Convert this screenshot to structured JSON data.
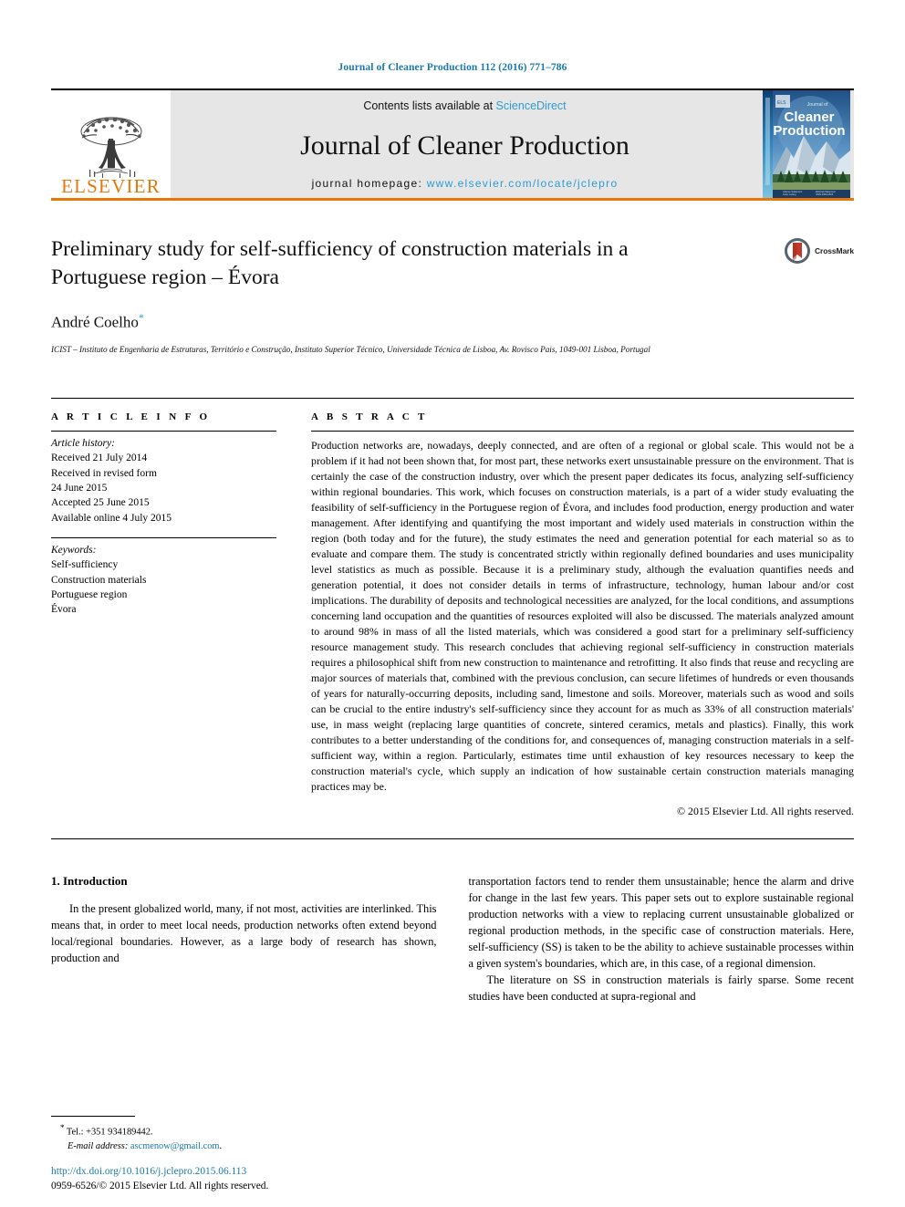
{
  "running_head": "Journal of Cleaner Production 112 (2016) 771–786",
  "masthead": {
    "publisher_name": "ELSEVIER",
    "contents_prefix": "Contents lists available at ",
    "contents_link": "ScienceDirect",
    "journal_name": "Journal of Cleaner Production",
    "homepage_prefix": "journal homepage: ",
    "homepage_url": "www.elsevier.com/locate/jclepro",
    "cover": {
      "kicker": "Journal of",
      "line1": "Cleaner",
      "line2": "Production"
    },
    "link_color": "#2e9bd0",
    "rule_color": "#e8770a",
    "band_color": "#e6e6e6"
  },
  "title_block": {
    "title": "Preliminary study for self-sufficiency of construction materials in a Portuguese region – Évora",
    "author": "André Coelho",
    "author_marker": "*",
    "affiliation": "ICIST – Instituto de Engenharia de Estruturas, Território e Construção, Instituto Superior Técnico, Universidade Técnica de Lisboa, Av. Rovisco Pais, 1049-001 Lisboa, Portugal",
    "crossmark_label": "CrossMark"
  },
  "article_info": {
    "heading": "A R T I C L E   I N F O",
    "history_label": "Article history:",
    "history": [
      "Received 21 July 2014",
      "Received in revised form",
      "24 June 2015",
      "Accepted 25 June 2015",
      "Available online 4 July 2015"
    ],
    "keywords_label": "Keywords:",
    "keywords": [
      "Self-sufficiency",
      "Construction materials",
      "Portuguese region",
      "Évora"
    ]
  },
  "abstract": {
    "heading": "A B S T R A C T",
    "text": "Production networks are, nowadays, deeply connected, and are often of a regional or global scale. This would not be a problem if it had not been shown that, for most part, these networks exert unsustainable pressure on the environment. That is certainly the case of the construction industry, over which the present paper dedicates its focus, analyzing self-sufficiency within regional boundaries. This work, which focuses on construction materials, is a part of a wider study evaluating the feasibility of self-sufficiency in the Portuguese region of Évora, and includes food production, energy production and water management. After identifying and quantifying the most important and widely used materials in construction within the region (both today and for the future), the study estimates the need and generation potential for each material so as to evaluate and compare them. The study is concentrated strictly within regionally defined boundaries and uses municipality level statistics as much as possible. Because it is a preliminary study, although the evaluation quantifies needs and generation potential, it does not consider details in terms of infrastructure, technology, human labour and/or cost implications. The durability of deposits and technological necessities are analyzed, for the local conditions, and assumptions concerning land occupation and the quantities of resources exploited will also be discussed. The materials analyzed amount to around 98% in mass of all the listed materials, which was considered a good start for a preliminary self-sufficiency resource management study. This research concludes that achieving regional self-sufficiency in construction materials requires a philosophical shift from new construction to maintenance and retrofitting. It also finds that reuse and recycling are major sources of materials that, combined with the previous conclusion, can secure lifetimes of hundreds or even thousands of years for naturally-occurring deposits, including sand, limestone and soils. Moreover, materials such as wood and soils can be crucial to the entire industry's self-sufficiency since they account for as much as 33% of all construction materials' use, in mass weight (replacing large quantities of concrete, sintered ceramics, metals and plastics). Finally, this work contributes to a better understanding of the conditions for, and consequences of, managing construction materials in a self-sufficient way, within a region. Particularly, estimates time until exhaustion of key resources necessary to keep the construction material's cycle, which supply an indication of how sustainable certain construction materials managing practices may be.",
    "copyright": "© 2015 Elsevier Ltd. All rights reserved."
  },
  "introduction": {
    "section_number_title": "1. Introduction",
    "left_para": "In the present globalized world, many, if not most, activities are interlinked. This means that, in order to meet local needs, production networks often extend beyond local/regional boundaries. However, as a large body of research has shown, production and",
    "right_para_1": "transportation factors tend to render them unsustainable; hence the alarm and drive for change in the last few years. This paper sets out to explore sustainable regional production networks with a view to replacing current unsustainable globalized or regional production methods, in the specific case of construction materials. Here, self-sufficiency (SS) is taken to be the ability to achieve sustainable processes within a given system's boundaries, which are, in this case, of a regional dimension.",
    "right_para_2": "The literature on SS in construction materials is fairly sparse. Some recent studies have been conducted at supra-regional and"
  },
  "footnote": {
    "marker": "*",
    "tel": "Tel.: +351 934189442.",
    "email_label": "E-mail address:",
    "email": "ascmenow@gmail.com",
    "email_trailing": "."
  },
  "footer": {
    "doi": "http://dx.doi.org/10.1016/j.jclepro.2015.06.113",
    "issn_line": "0959-6526/© 2015 Elsevier Ltd. All rights reserved."
  }
}
